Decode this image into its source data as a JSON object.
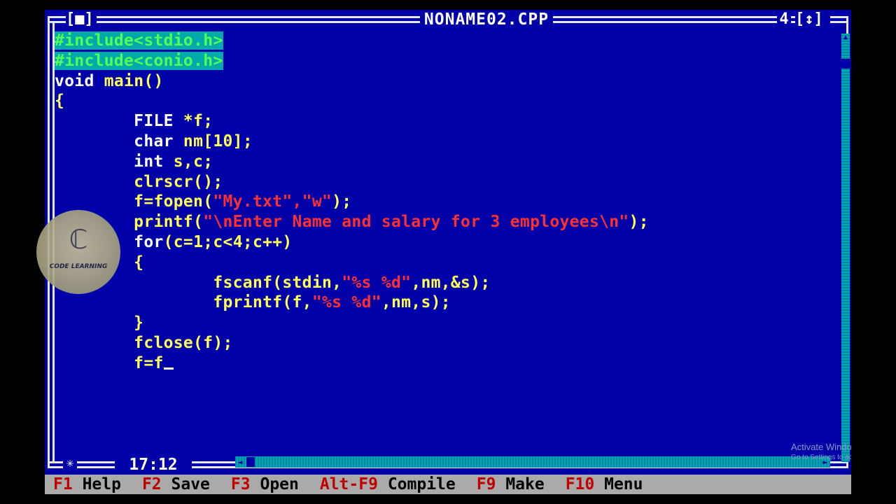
{
  "window": {
    "title": "NONAME02.CPP",
    "close_button": "[■]",
    "window_number": "4",
    "zoom_button": "[↕]",
    "cursor_position": "17:12"
  },
  "editor": {
    "lines": [
      [
        {
          "t": "#include<stdio.h>",
          "c": "pp hl"
        }
      ],
      [
        {
          "t": "#include<conio.h>",
          "c": "pp hl"
        }
      ],
      [
        {
          "t": "void ",
          "c": "kw"
        },
        {
          "t": "main()",
          "c": "ident"
        }
      ],
      [
        {
          "t": "{",
          "c": "sym"
        }
      ],
      [
        {
          "t": "        FILE ",
          "c": "kw"
        },
        {
          "t": "*f;",
          "c": "ident"
        }
      ],
      [
        {
          "t": "        char ",
          "c": "kw"
        },
        {
          "t": "nm[",
          "c": "ident"
        },
        {
          "t": "10",
          "c": "num"
        },
        {
          "t": "];",
          "c": "ident"
        }
      ],
      [
        {
          "t": "        int ",
          "c": "kw"
        },
        {
          "t": "s,c;",
          "c": "ident"
        }
      ],
      [
        {
          "t": "        clrscr();",
          "c": "ident"
        }
      ],
      [
        {
          "t": "        f=fopen(",
          "c": "ident"
        },
        {
          "t": "\"My.txt\",\"w\"",
          "c": "str"
        },
        {
          "t": ");",
          "c": "ident"
        }
      ],
      [
        {
          "t": "        printf(",
          "c": "ident"
        },
        {
          "t": "\"\\nEnter Name and salary for 3 employees\\n\"",
          "c": "str"
        },
        {
          "t": ");",
          "c": "ident"
        }
      ],
      [
        {
          "t": "        for",
          "c": "kw"
        },
        {
          "t": "(c=",
          "c": "ident"
        },
        {
          "t": "1",
          "c": "num"
        },
        {
          "t": ";c<",
          "c": "ident"
        },
        {
          "t": "4",
          "c": "num"
        },
        {
          "t": ";c++)",
          "c": "ident"
        }
      ],
      [
        {
          "t": "        {",
          "c": "sym"
        }
      ],
      [
        {
          "t": "                fscanf(stdin,",
          "c": "ident"
        },
        {
          "t": "\"%s %d\"",
          "c": "str"
        },
        {
          "t": ",nm,&s);",
          "c": "ident"
        }
      ],
      [
        {
          "t": "                fprintf(f,",
          "c": "ident"
        },
        {
          "t": "\"%s %d\"",
          "c": "str"
        },
        {
          "t": ",nm,s);",
          "c": "ident"
        }
      ],
      [
        {
          "t": "        }",
          "c": "sym"
        }
      ],
      [
        {
          "t": "        fclose(f);",
          "c": "ident"
        }
      ],
      [
        {
          "t": "        f=f",
          "c": "ident"
        }
      ]
    ],
    "cursor_line": 16
  },
  "menu": {
    "items": [
      {
        "key": "F1",
        "label": "Help"
      },
      {
        "key": "F2",
        "label": "Save"
      },
      {
        "key": "F3",
        "label": "Open"
      },
      {
        "key": "Alt-F9",
        "label": "Compile"
      },
      {
        "key": "F9",
        "label": "Make"
      },
      {
        "key": "F10",
        "label": "Menu"
      }
    ]
  },
  "watermark": {
    "logo_text": "CODE LEARNING",
    "activate_title": "Activate Windows",
    "activate_sub": "Go to Settings to activate Windows."
  },
  "colors": {
    "background": "#0000A8",
    "string": "#FF3030",
    "identifier": "#FFFF55",
    "preprocessor": "#55FF55",
    "menu_bar": "#AAAAAA"
  }
}
